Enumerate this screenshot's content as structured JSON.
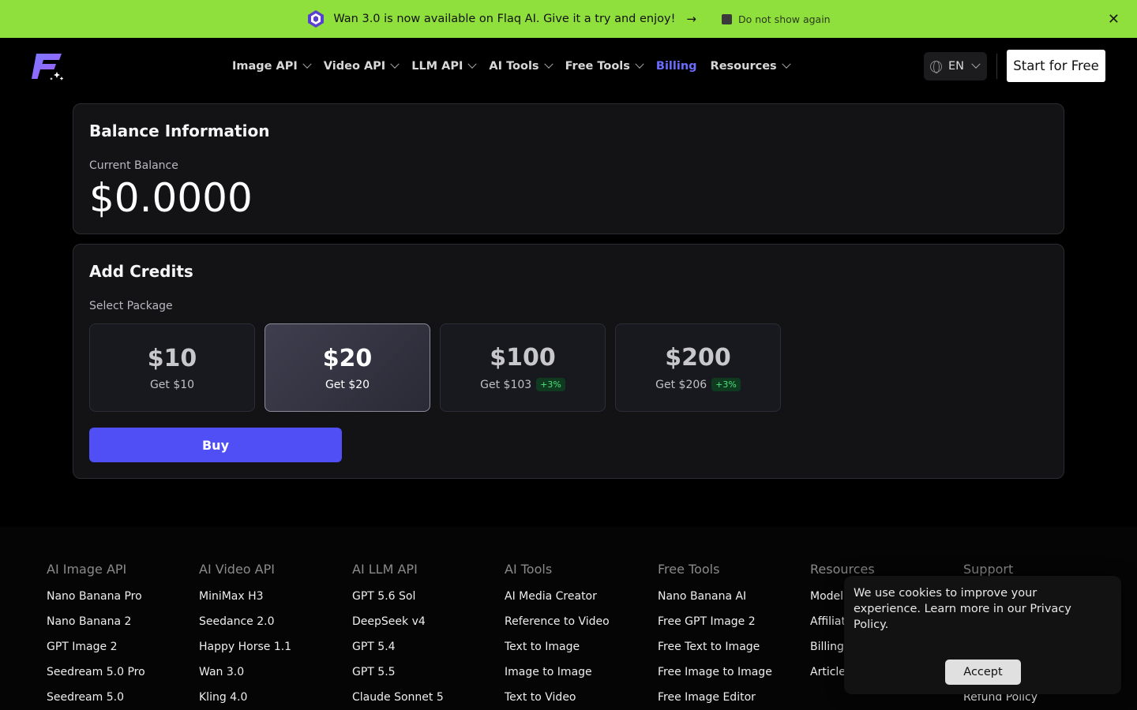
{
  "announcement": {
    "text": "Wan 3.0 is now available on Flaq AI. Give it a try and enjoy!",
    "arrow": "→",
    "dont_show": "Do not show again",
    "close": "✕",
    "bg_color": "#8fe03c"
  },
  "header": {
    "nav": [
      {
        "label": "Image API",
        "dropdown": true
      },
      {
        "label": "Video API",
        "dropdown": true
      },
      {
        "label": "LLM API",
        "dropdown": true
      },
      {
        "label": "AI Tools",
        "dropdown": true
      },
      {
        "label": "Free Tools",
        "dropdown": true
      },
      {
        "label": "Billing",
        "dropdown": false,
        "active": true
      },
      {
        "label": "Resources",
        "dropdown": true
      }
    ],
    "language": "EN",
    "start_button": "Start for Free",
    "accent_color": "#6b6bff"
  },
  "balance": {
    "title": "Balance Information",
    "label": "Current Balance",
    "value": "$0.0000"
  },
  "credits": {
    "title": "Add Credits",
    "label": "Select Package",
    "packages": [
      {
        "price": "$10",
        "get": "Get $10",
        "bonus": ""
      },
      {
        "price": "$20",
        "get": "Get $20",
        "bonus": "",
        "selected": true
      },
      {
        "price": "$100",
        "get": "Get $103",
        "bonus": "+3%"
      },
      {
        "price": "$200",
        "get": "Get $206",
        "bonus": "+3%"
      }
    ],
    "buy_label": "Buy",
    "buy_color": "#4f4ff5"
  },
  "footer": {
    "columns": [
      {
        "heading": "AI Image API",
        "links": [
          "Nano Banana Pro",
          "Nano Banana 2",
          "GPT Image 2",
          "Seedream 5.0 Pro",
          "Seedream 5.0"
        ]
      },
      {
        "heading": "AI Video API",
        "links": [
          "MiniMax H3",
          "Seedance 2.0",
          "Happy Horse 1.1",
          "Wan 3.0",
          "Kling 4.0"
        ]
      },
      {
        "heading": "AI LLM API",
        "links": [
          "GPT 5.6 Sol",
          "DeepSeek v4",
          "GPT 5.4",
          "GPT 5.5",
          "Claude Sonnet 5"
        ]
      },
      {
        "heading": "AI Tools",
        "links": [
          "AI Media Creator",
          "Reference to Video",
          "Text to Image",
          "Image to Image",
          "Text to Video"
        ]
      },
      {
        "heading": "Free Tools",
        "links": [
          "Nano Banana AI",
          "Free GPT Image 2",
          "Free Text to Image",
          "Free Image to Image",
          "Free Image Editor"
        ]
      },
      {
        "heading": "Resources",
        "links": [
          "Model",
          "Affiliat",
          "Billing",
          "Article"
        ]
      },
      {
        "heading": "Support",
        "links": [
          "",
          "",
          "",
          "",
          "Refund Policy"
        ]
      }
    ]
  },
  "cookie": {
    "text": "We use cookies to improve your experience. Learn more in our Privacy Policy.",
    "accept": "Accept"
  }
}
